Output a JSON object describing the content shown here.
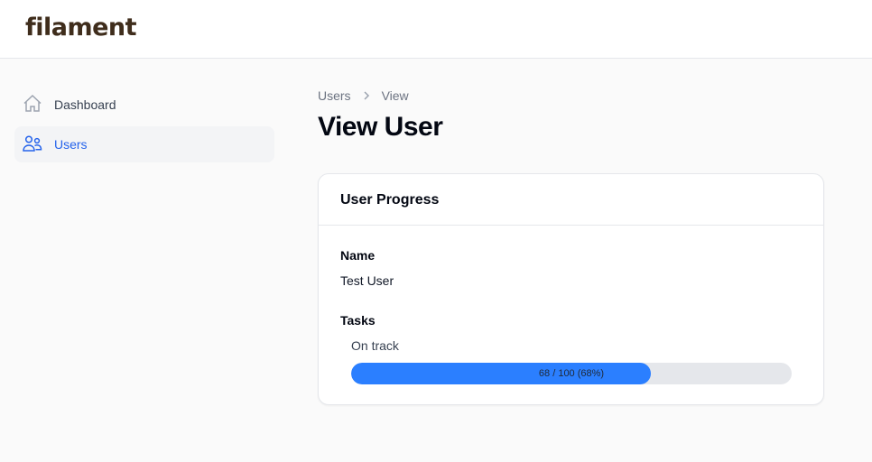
{
  "brand": {
    "logo": "filament"
  },
  "sidebar": {
    "items": [
      {
        "label": "Dashboard",
        "active": false
      },
      {
        "label": "Users",
        "active": true
      }
    ]
  },
  "breadcrumb": [
    "Users",
    "View"
  ],
  "page": {
    "title": "View User"
  },
  "card": {
    "title": "User Progress",
    "name_label": "Name",
    "name_value": "Test User",
    "tasks_label": "Tasks",
    "status": "On track",
    "progress": {
      "value": 68,
      "max": 100,
      "percent": 68,
      "text": "68 / 100 (68%)"
    },
    "colors": {
      "fill": "#2b7fff",
      "track": "#e5e7eb"
    }
  }
}
